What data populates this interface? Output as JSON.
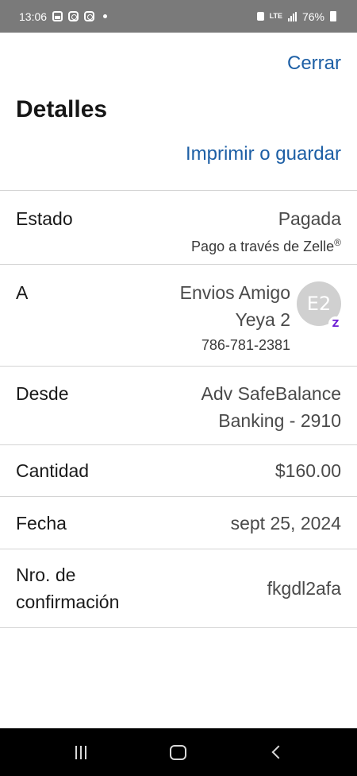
{
  "status_bar": {
    "time": "13:06",
    "network": "LTE",
    "battery": "76%"
  },
  "header": {
    "close_label": "Cerrar",
    "title": "Detalles",
    "print_label": "Imprimir o guardar"
  },
  "details": {
    "status": {
      "label": "Estado",
      "value": "Pagada",
      "sub_prefix": "Pago a través de Zelle",
      "sub_mark": "®"
    },
    "to": {
      "label": "A",
      "name_line1": "Envios Amigo",
      "name_line2": "Yeya 2",
      "phone": "786-781-2381",
      "avatar_initials": "E2",
      "badge": "Z"
    },
    "from": {
      "label": "Desde",
      "account_line1": "Adv SafeBalance",
      "account_line2": "Banking - 2910"
    },
    "amount": {
      "label": "Cantidad",
      "value": "$160.00"
    },
    "date": {
      "label": "Fecha",
      "value": "sept 25, 2024"
    },
    "confirmation": {
      "label_line1": "Nro. de",
      "label_line2": "confirmación",
      "value": "fkgdl2afa"
    }
  },
  "colors": {
    "link": "#1d5fa5",
    "zelle": "#6d1ed4"
  }
}
